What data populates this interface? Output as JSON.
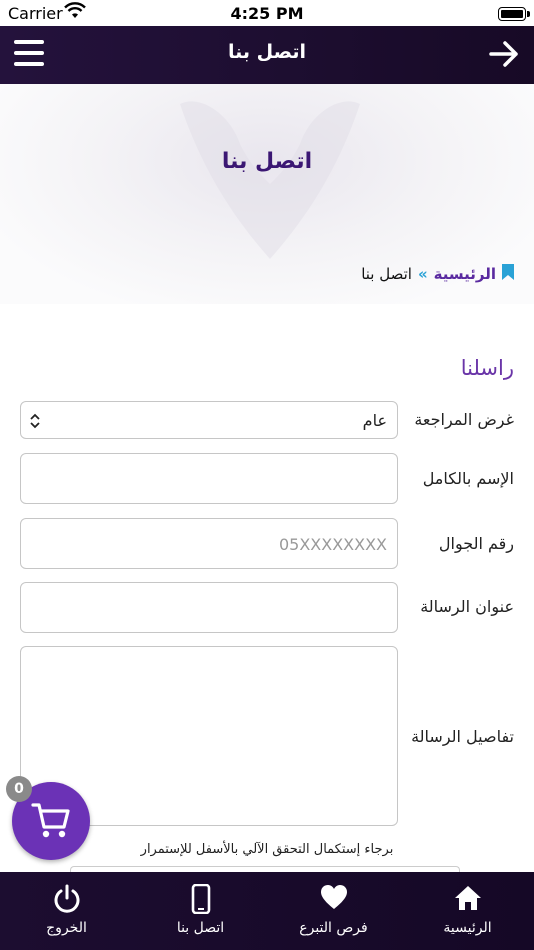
{
  "status_bar": {
    "carrier": "Carrier",
    "time": "4:25 PM"
  },
  "header": {
    "title": "اتصل بنا"
  },
  "hero": {
    "title": "اتصل بنا"
  },
  "breadcrumb": {
    "home": "الرئيسية",
    "separator": "»",
    "current": "اتصل بنا"
  },
  "form": {
    "title": "راسلنا",
    "purpose_label": "غرض المراجعة",
    "purpose_value": "عام",
    "name_label": "الإسم بالكامل",
    "name_value": "",
    "mobile_label": "رقم الجوال",
    "mobile_placeholder": "05XXXXXXXX",
    "subject_label": "عنوان الرسالة",
    "subject_value": "",
    "details_label": "تفاصيل الرسالة",
    "details_value": "",
    "captcha_note": "برجاء إستكمال التحقق الآلي بالأسفل للإستمرار"
  },
  "cart": {
    "count": "0"
  },
  "tabs": [
    {
      "label": "الرئيسية",
      "icon": "home-icon"
    },
    {
      "label": "فرص التبرع",
      "icon": "heart-icon"
    },
    {
      "label": "اتصل بنا",
      "icon": "phone-icon"
    },
    {
      "label": "الخروج",
      "icon": "power-icon"
    }
  ],
  "colors": {
    "header_bg": "#24123c",
    "accent": "#6b32b6",
    "title": "#3b1773",
    "separator": "#2aa2d6"
  }
}
